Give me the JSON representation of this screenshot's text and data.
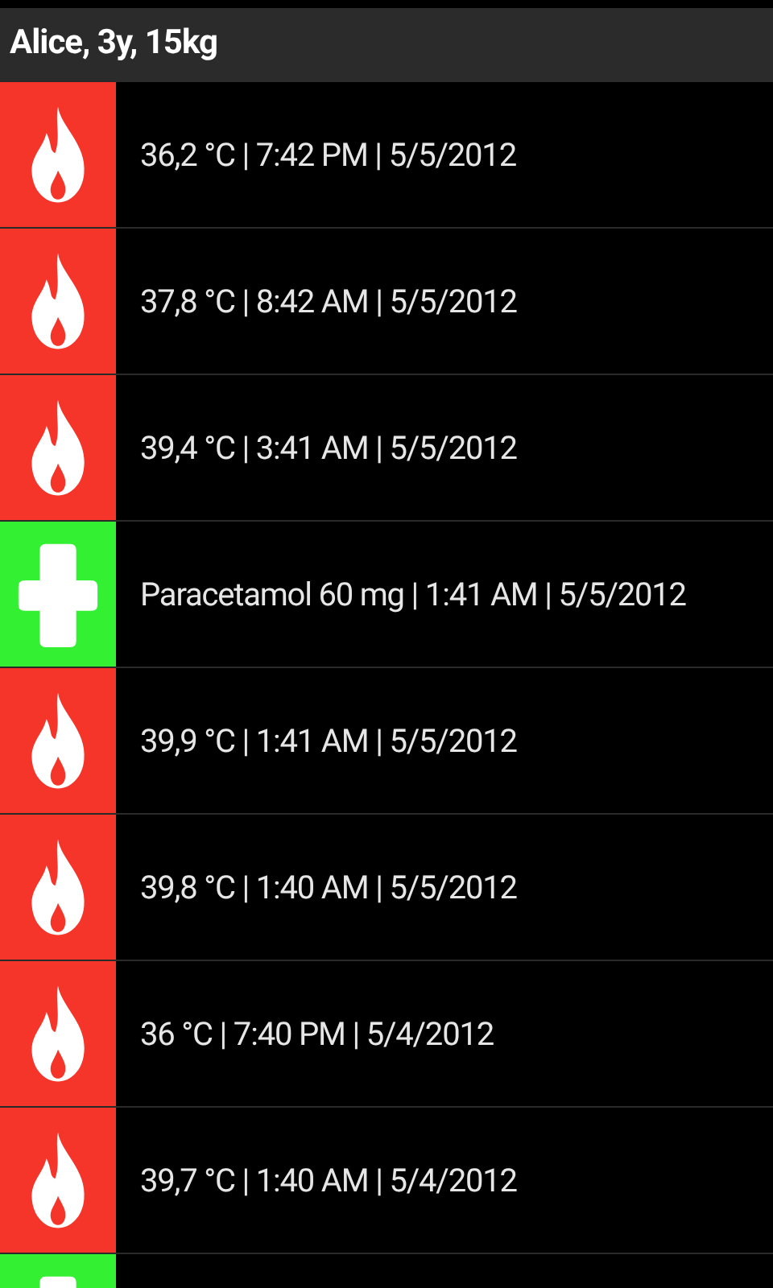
{
  "header": {
    "title": "Alice, 3y, 15kg"
  },
  "entries": [
    {
      "kind": "temperature",
      "text": "36,2 °C | 7:42 PM | 5/5/2012"
    },
    {
      "kind": "temperature",
      "text": "37,8 °C | 8:42 AM | 5/5/2012"
    },
    {
      "kind": "temperature",
      "text": "39,4 °C | 3:41 AM | 5/5/2012"
    },
    {
      "kind": "medication",
      "text": "Paracetamol 60 mg | 1:41 AM | 5/5/2012"
    },
    {
      "kind": "temperature",
      "text": "39,9 °C | 1:41 AM | 5/5/2012"
    },
    {
      "kind": "temperature",
      "text": "39,8 °C | 1:40 AM | 5/5/2012"
    },
    {
      "kind": "temperature",
      "text": "36 °C | 7:40 PM | 5/4/2012"
    },
    {
      "kind": "temperature",
      "text": "39,7 °C | 1:40 AM | 5/4/2012"
    },
    {
      "kind": "medication"
    }
  ]
}
